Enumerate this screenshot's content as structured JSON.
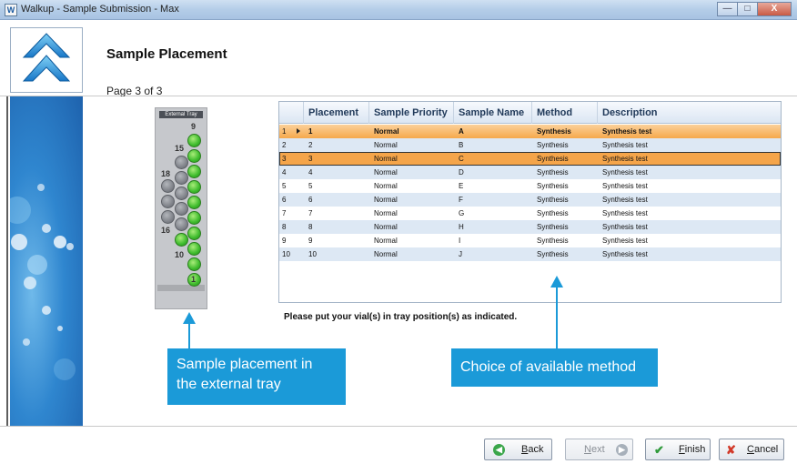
{
  "window": {
    "title": "Walkup - Sample Submission - Max",
    "app_icon_letter": "W",
    "minimize_glyph": "—",
    "maximize_glyph": "□",
    "close_glyph": "X"
  },
  "header": {
    "title": "Sample Placement",
    "page": "Page 3 of 3"
  },
  "tray": {
    "label": "External Tray",
    "numbers": [
      "9",
      "15",
      "18",
      "16",
      "10",
      "1"
    ]
  },
  "grid": {
    "columns": [
      "Placement",
      "Sample Priority",
      "Sample Name",
      "Method",
      "Description"
    ],
    "rows": [
      {
        "num": "1",
        "placement": "1",
        "priority": "Normal",
        "name": "A",
        "method": "Synthesis",
        "description": "Synthesis test"
      },
      {
        "num": "2",
        "placement": "2",
        "priority": "Normal",
        "name": "B",
        "method": "Synthesis",
        "description": "Synthesis test"
      },
      {
        "num": "3",
        "placement": "3",
        "priority": "Normal",
        "name": "C",
        "method": "Synthesis",
        "description": "Synthesis test"
      },
      {
        "num": "4",
        "placement": "4",
        "priority": "Normal",
        "name": "D",
        "method": "Synthesis",
        "description": "Synthesis test"
      },
      {
        "num": "5",
        "placement": "5",
        "priority": "Normal",
        "name": "E",
        "method": "Synthesis",
        "description": "Synthesis test"
      },
      {
        "num": "6",
        "placement": "6",
        "priority": "Normal",
        "name": "F",
        "method": "Synthesis",
        "description": "Synthesis test"
      },
      {
        "num": "7",
        "placement": "7",
        "priority": "Normal",
        "name": "G",
        "method": "Synthesis",
        "description": "Synthesis test"
      },
      {
        "num": "8",
        "placement": "8",
        "priority": "Normal",
        "name": "H",
        "method": "Synthesis",
        "description": "Synthesis test"
      },
      {
        "num": "9",
        "placement": "9",
        "priority": "Normal",
        "name": "I",
        "method": "Synthesis",
        "description": "Synthesis test"
      },
      {
        "num": "10",
        "placement": "10",
        "priority": "Normal",
        "name": "J",
        "method": "Synthesis",
        "description": "Synthesis test"
      }
    ]
  },
  "instruction": "Please put your vial(s) in tray position(s) as indicated.",
  "callouts": {
    "tray_line1": "Sample placement in",
    "tray_line2": "the external tray",
    "method": "Choice of available method"
  },
  "buttons": {
    "back": {
      "underline": "B",
      "rest": "ack"
    },
    "next": {
      "underline": "N",
      "rest": "ext"
    },
    "finish": {
      "underline": "F",
      "rest": "inish"
    },
    "cancel": {
      "underline": "C",
      "rest": "ancel"
    }
  },
  "icons": {
    "app": "app-icon",
    "logo": "double-chevron-up-logo",
    "back": "back-arrow-icon",
    "next": "next-arrow-icon",
    "finish": "checkmark-icon",
    "cancel": "cross-icon"
  },
  "colors": {
    "callout": "#1b9ad8",
    "highlight_row": "#f6a94c",
    "selected_row": "#f5a54a",
    "vial_green": "#3dbb2c",
    "vial_grey": "#7d8087"
  }
}
